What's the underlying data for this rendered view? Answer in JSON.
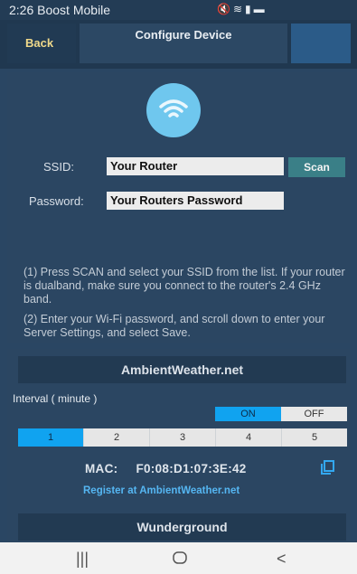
{
  "status": {
    "time": "2:26",
    "carrier": "Boost Mobile",
    "icons": [
      "mute-icon",
      "wifi-icon",
      "signal-icon",
      "battery-icon"
    ]
  },
  "header": {
    "back_label": "Back",
    "title": "Configure Device"
  },
  "wifi": {
    "ssid_label": "SSID:",
    "ssid_value": "Your Router",
    "scan_label": "Scan",
    "password_label": "Password:",
    "password_value": "Your Routers Password"
  },
  "instructions": [
    "(1) Press SCAN and select your SSID from the list. If your router is dualband, make sure you connect to the router's 2.4 GHz band.",
    "(2) Enter your Wi-Fi password, and scroll down to enter your Server Settings, and select Save."
  ],
  "ambient": {
    "title": "AmbientWeather.net",
    "interval_label": "Interval ( minute )",
    "toggle_on": "ON",
    "toggle_off": "OFF",
    "intervals": [
      "1",
      "2",
      "3",
      "4",
      "5"
    ],
    "selected_interval": "1",
    "mac_label": "MAC:",
    "mac_value": "F0:08:D1:07:3E:42",
    "register_label": "Register at AmbientWeather.net"
  },
  "wunderground": {
    "title": "Wunderground"
  },
  "colors": {
    "accent": "#10a3f0",
    "back_text": "#f0d98a",
    "link": "#55b6f2"
  }
}
